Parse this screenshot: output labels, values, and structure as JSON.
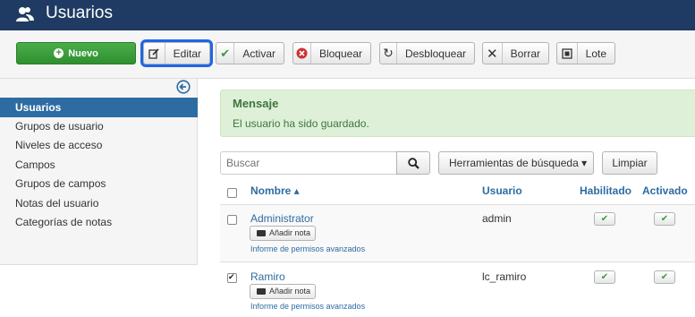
{
  "header": {
    "title": "Usuarios",
    "icon": "users-icon"
  },
  "toolbar": {
    "new_label": "Nuevo",
    "edit_label": "Editar",
    "activate_label": "Activar",
    "block_label": "Bloquear",
    "unblock_label": "Desbloquear",
    "delete_label": "Borrar",
    "batch_label": "Lote"
  },
  "sidebar": {
    "items": [
      {
        "label": "Usuarios",
        "active": true
      },
      {
        "label": "Grupos de usuario"
      },
      {
        "label": "Niveles de acceso"
      },
      {
        "label": "Campos"
      },
      {
        "label": "Grupos de campos"
      },
      {
        "label": "Notas del usuario"
      },
      {
        "label": "Categorías de notas"
      }
    ]
  },
  "message": {
    "title": "Mensaje",
    "body": "El usuario ha sido guardado."
  },
  "search": {
    "placeholder": "Buscar",
    "tools_label": "Herramientas de búsqueda ▾",
    "clear_label": "Limpiar"
  },
  "table": {
    "headers": {
      "name": "Nombre ▴",
      "username": "Usuario",
      "enabled": "Habilitado",
      "activated": "Activado"
    },
    "rows": [
      {
        "name": "Administrator",
        "note_label": "Añadir nota",
        "perm_label": "Informe de permisos avanzados",
        "username": "admin",
        "checked": false
      },
      {
        "name": "Ramiro",
        "note_label": "Añadir nota",
        "perm_label": "Informe de permisos avanzados",
        "username": "lc_ramiro",
        "checked": true
      }
    ]
  },
  "colors": {
    "header_bg": "#1f3b63",
    "accent": "#2d6ca2",
    "success_bg": "#dff0d8",
    "new_button": "#3a9c3a",
    "focus_outline": "#1f66e5"
  }
}
